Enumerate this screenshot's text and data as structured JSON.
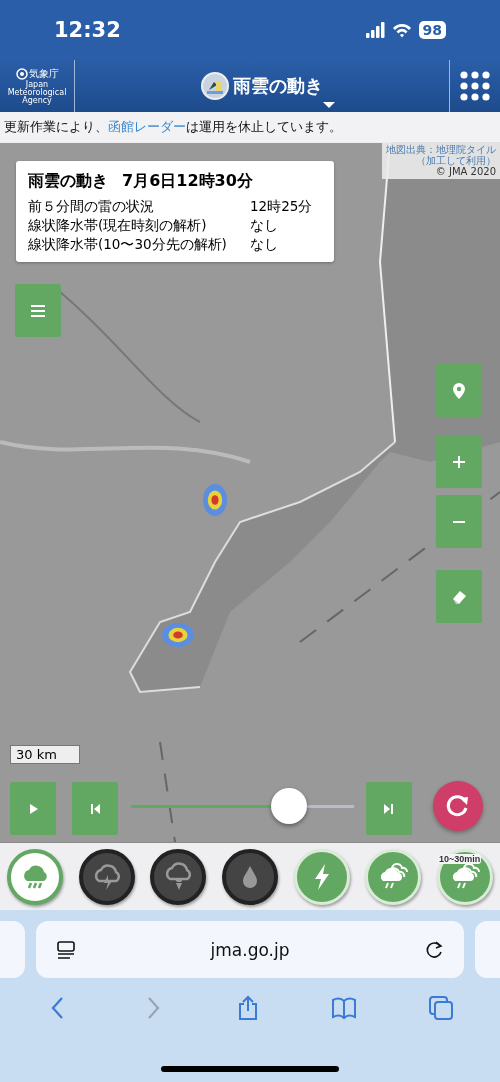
{
  "status_bar": {
    "time": "12:32",
    "battery": "98"
  },
  "header": {
    "logo_text": "気象庁",
    "logo_subtext": "Japan Meteorological Agency",
    "title": "雨雲の動き"
  },
  "notice": {
    "before": "更新作業により、",
    "link": "函館レーダー",
    "after": "は運用を休止しています。"
  },
  "map": {
    "attribution": [
      "地図出典：地理院タイル",
      "（加工して利用）",
      "© JMA 2020"
    ],
    "info": {
      "title": "雨雲の動き",
      "datetime": "7月6日12時30分",
      "rows": [
        {
          "label": "前５分間の雷の状況",
          "value": "12時25分"
        },
        {
          "label": "線状降水帯(現在時刻の解析)",
          "value": "なし"
        },
        {
          "label": "線状降水帯(10〜30分先の解析)",
          "value": "なし"
        }
      ]
    },
    "scale": "30 km",
    "slider": {
      "level": 0.71
    }
  },
  "layers": [
    {
      "kind": "rain",
      "selected": true,
      "on": true
    },
    {
      "kind": "thunder",
      "selected": false,
      "on": false
    },
    {
      "kind": "tornado",
      "selected": false,
      "on": false
    },
    {
      "kind": "drop",
      "selected": false,
      "on": false
    },
    {
      "kind": "lightning",
      "selected": false,
      "on": true
    },
    {
      "kind": "band",
      "selected": false,
      "on": true
    },
    {
      "kind": "band",
      "selected": false,
      "on": true,
      "label": "10~30min"
    }
  ],
  "browser": {
    "url": "jma.go.jp"
  }
}
